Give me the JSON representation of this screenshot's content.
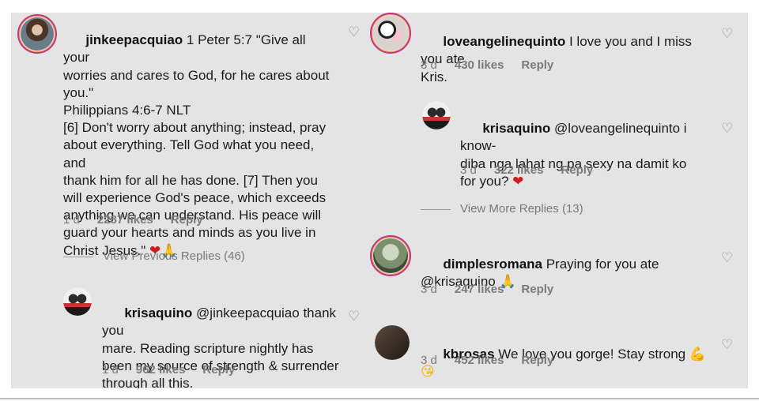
{
  "left": {
    "comments": [
      {
        "username": "jinkeepacquiao",
        "text": " 1 Peter 5:7 \"Give all your\nworries and cares to God, for he cares about\nyou.\"\nPhilippians 4:6-7 NLT\n[6] Don't worry about anything; instead, pray\nabout everything. Tell God what you need, and\nthank him for all he has done. [7] Then you\nwill experience God's peace, which exceeds\nanything we can understand. His peace will\nguard your hearts and minds as you live in\nChrist Jesus.\" ",
        "emoji": [
          "❤",
          "🙏"
        ],
        "time": "1 d",
        "likes": "2287 likes",
        "reply": "Reply"
      },
      {
        "username": "krisaquino",
        "text": " @jinkeepacquiao thank you\nmare. Reading scripture nightly has\nbeen my source of strength & surrender\nthrough all this.",
        "time": "1 d",
        "likes": "962 likes",
        "reply": "Reply"
      }
    ],
    "view_previous": "View Previous Replies (46)"
  },
  "right": {
    "comments": [
      {
        "username": "loveangelinequinto",
        "text": " I love you and I miss you ate\nKris.",
        "time": "3 d",
        "likes": "430 likes",
        "reply": "Reply"
      },
      {
        "username": "krisaquino",
        "text": " @loveangelinequinto i know-\ndiba nga lahat ng pa sexy na damit ko\nfor you? ",
        "emoji": [
          "❤"
        ],
        "time": "3 d",
        "likes": "322 likes",
        "reply": "Reply"
      },
      {
        "username": "dimplesromana",
        "text": " Praying for you ate\n@krisaquino ",
        "emoji": [
          "🙏"
        ],
        "time": "3 d",
        "likes": "247 likes",
        "reply": "Reply"
      },
      {
        "username": "kbrosas",
        "text": " We love you gorge! Stay strong ",
        "emoji": [
          "💪",
          "😘"
        ],
        "time": "3 d",
        "likes": "452 likes",
        "reply": "Reply"
      }
    ],
    "view_more": "View More Replies (13)"
  },
  "icons": {
    "like": "heart-outline-icon"
  },
  "colors": {
    "story_ring": "#c13584",
    "panel_bg": "#e4e4e4",
    "meta_text": "#7a7a7a"
  }
}
